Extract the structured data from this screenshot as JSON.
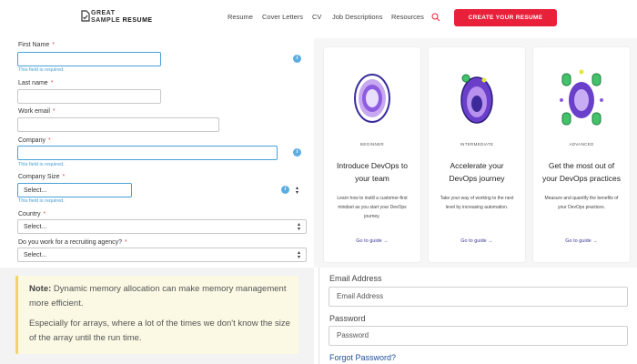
{
  "header": {
    "logo_line1": "GREAT",
    "logo_line2_a": "SAMPLE ",
    "logo_line2_b": "RESUME",
    "nav": [
      "Resume",
      "Cover Letters",
      "CV",
      "Job Descriptions",
      "Resources"
    ],
    "cta_label": "CREATE YOUR RESUME",
    "accent": "#e8203a"
  },
  "form": {
    "first_name_label": "First Name",
    "last_name_label": "Last name",
    "work_email_label": "Work email",
    "company_label": "Company",
    "company_size_label": "Company Size",
    "country_label": "Country",
    "agency_label": "Do you work for a recruiting agency?",
    "required_mark": "*",
    "error_text": "This field is required.",
    "select_placeholder": "Select..."
  },
  "cards": [
    {
      "level": "BEGINNER",
      "title": "Introduce DevOps to your team",
      "desc": "Learn how to instill a customer-first mindset as you start your DevOps journey.",
      "link": "Go to guide →"
    },
    {
      "level": "INTERMEDIATE",
      "title": "Accelerate your DevOps journey",
      "desc": "Take your way of working to the next level by increasing automation.",
      "link": "Go to guide →"
    },
    {
      "level": "ADVANCED",
      "title": "Get the most out of your DevOps practices",
      "desc": "Measure and quantify the benefits of your DevOps practices.",
      "link": "Go to guide →"
    }
  ],
  "note": {
    "label": "Note:",
    "line1": " Dynamic memory allocation can make memory management more efficient.",
    "line2": "Especially for arrays, where a lot of the times we don't know the size of the array until the run time."
  },
  "login": {
    "email_label": "Email Address",
    "email_placeholder": "Email Address",
    "password_label": "Password",
    "password_placeholder": "Password",
    "forgot": "Forgot Password?"
  }
}
